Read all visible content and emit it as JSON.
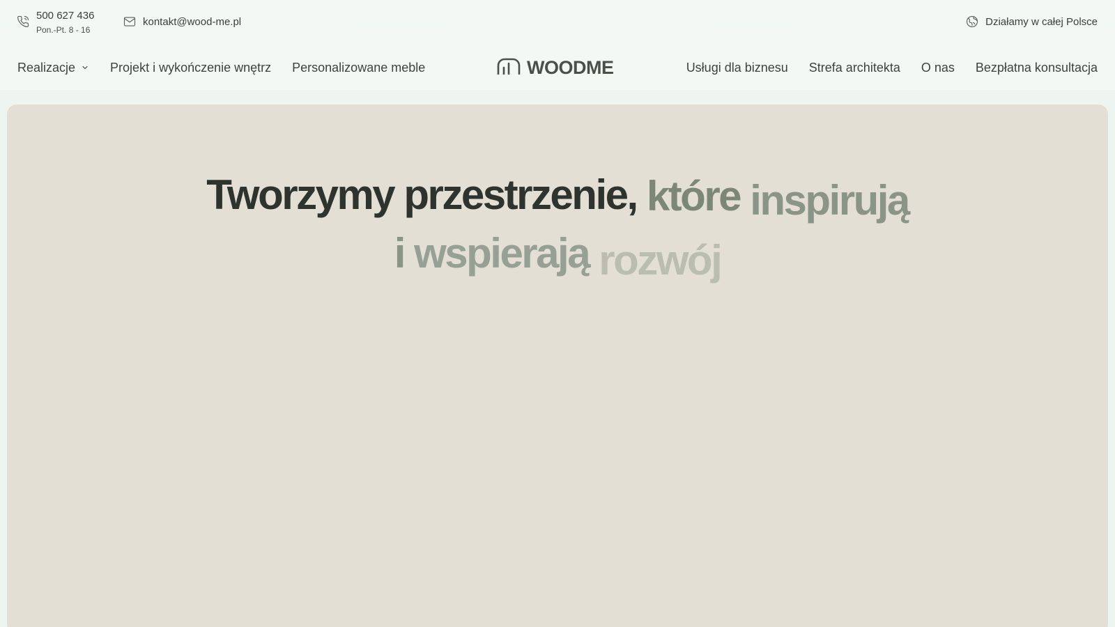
{
  "topbar": {
    "phone": "500 627 436",
    "hours": "Pon.-Pt. 8 - 16",
    "email": "kontakt@wood-me.pl",
    "region": "Działamy w całej Polsce"
  },
  "nav": {
    "left": [
      {
        "label": "Realizacje"
      },
      {
        "label": "Projekt i wykończenie wnętrz"
      },
      {
        "label": "Personalizowane meble"
      }
    ],
    "logo": "WOODME",
    "right": [
      {
        "label": "Usługi dla biznesu"
      },
      {
        "label": "Strefa architekta"
      },
      {
        "label": "O nas"
      },
      {
        "label": "Bezpłatna konsultacja"
      }
    ]
  },
  "hero": {
    "headline_words": [
      "Tworzymy",
      "przestrzenie,",
      "które",
      "inspirują",
      "i",
      "wspierają",
      "rozwój"
    ]
  },
  "colors": {
    "page_bg": "#eef4f0",
    "hero_bg": "#e4dfd4",
    "text_dark": "#2f332e",
    "text_sage": "#8b9587",
    "text_light": "#bbbdb0"
  }
}
